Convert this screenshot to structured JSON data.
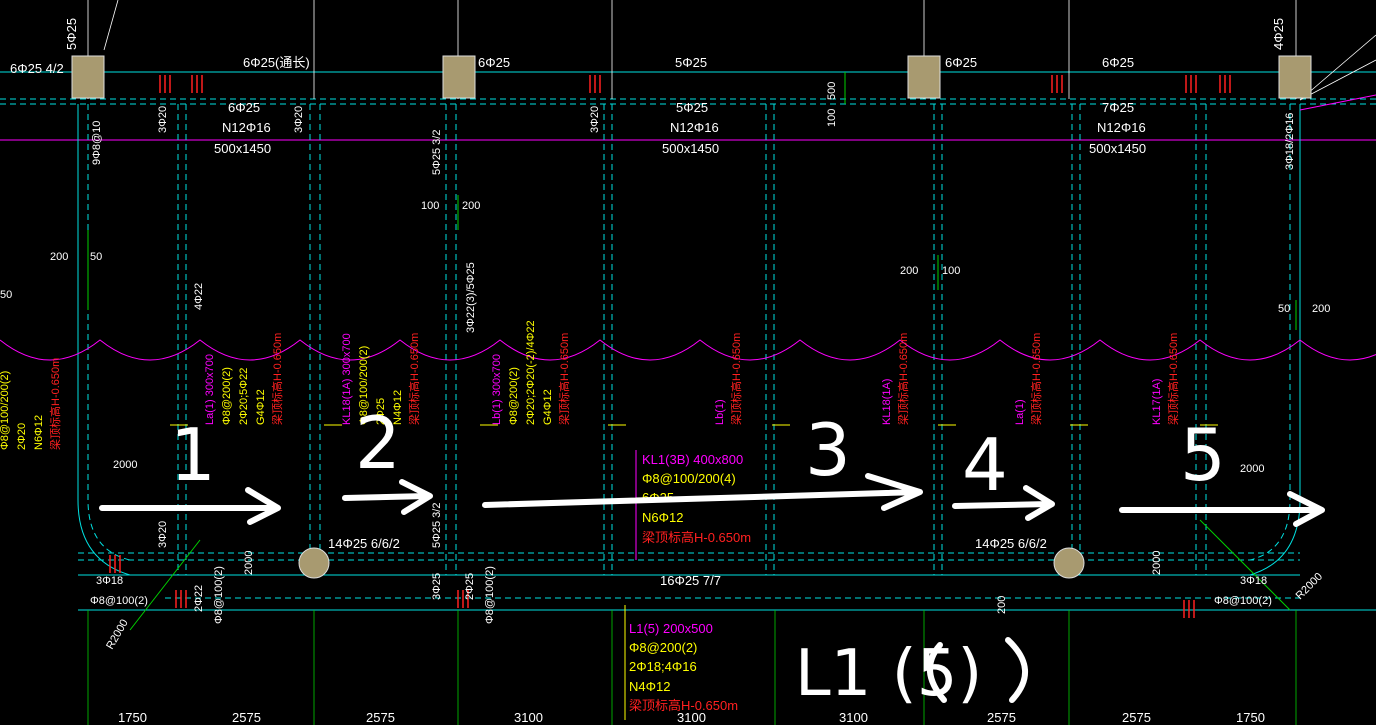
{
  "colors": {
    "bg": "#000000",
    "dim": "#ffffff",
    "grid_cyan": "#00e0e0",
    "green": "#00d000",
    "yellow": "#ffff00",
    "magenta": "#ff00ff",
    "red": "#ff2020",
    "column_fill": "#a89a70",
    "handwriting": "#ffffff"
  },
  "top_rebar": [
    "6Φ25 4/2",
    "6Φ25(通长)",
    "6Φ25",
    "5Φ25",
    "6Φ25",
    "6Φ25"
  ],
  "top_vertical": [
    "5Φ25",
    "4Φ25"
  ],
  "beam_groups": [
    {
      "rebar": "6Φ25",
      "torsion": "N12Φ16",
      "size": "500x1450"
    },
    {
      "rebar": "5Φ25",
      "torsion": "N12Φ16",
      "size": "500x1450"
    },
    {
      "rebar": "7Φ25",
      "torsion": "N12Φ16",
      "size": "500x1450"
    }
  ],
  "small_verticals": [
    "3Φ20",
    "3Φ20",
    "3Φ20",
    "5Φ25 3/2",
    "9Φ8@10",
    "3Φ18/2Φ16",
    "4Φ22",
    "3Φ22(3)/5Φ25"
  ],
  "dims_mid": [
    "200",
    "50",
    "50",
    "100",
    "200",
    "200",
    "100",
    "50",
    "200",
    "500",
    "100"
  ],
  "vertical_labels": [
    {
      "id": "lc1",
      "lines": [
        "Φ8@100/200(2)",
        "2Φ20",
        "N6Φ12",
        "梁顶标高H-0.650m"
      ]
    },
    {
      "id": "la1",
      "lines": [
        "La(1) 300x700",
        "Φ8@200(2)",
        "2Φ20;5Φ22",
        "G4Φ12",
        "梁顶标高H-0.650m"
      ]
    },
    {
      "id": "kl18a",
      "lines": [
        "KL18(1A) 300x700",
        "Φ8@100/200(2)",
        "2Φ25",
        "N4Φ12",
        "梁顶标高H-0.650m"
      ]
    },
    {
      "id": "lb1a",
      "lines": [
        "Lb(1) 300x700",
        "Φ8@200(2)",
        "2Φ20;2Φ20(-2)/4Φ22",
        "G4Φ12",
        "梁顶标高H-0.650m"
      ]
    },
    {
      "id": "lb1b",
      "lines": [
        "Lb(1)",
        "梁顶标高H-0.650m"
      ]
    },
    {
      "id": "kl18b",
      "lines": [
        "KL18(1A)",
        "梁顶标高H-0.650m"
      ]
    },
    {
      "id": "la1b",
      "lines": [
        "La(1)",
        "梁顶标高H-0.650m"
      ]
    },
    {
      "id": "kl17",
      "lines": [
        "KL17(1A)",
        "梁顶标高H-0.650m"
      ]
    }
  ],
  "kl1": [
    "KL1(3B) 400x800",
    "Φ8@100/200(4)",
    "6Φ25",
    "N6Φ12",
    "梁顶标高H-0.650m"
  ],
  "l1": [
    "L1(5) 200x500",
    "Φ8@200(2)",
    "2Φ18;4Φ16",
    "N4Φ12",
    "梁顶标高H-0.650m"
  ],
  "bottom_rebar": [
    "14Φ25 6/6/2",
    "16Φ25 7/7",
    "14Φ25 6/6/2"
  ],
  "bottom_small": [
    "3Φ18",
    "Φ8@100(2)",
    "2Φ22",
    "Φ8@100(2)",
    "3Φ25",
    "2Φ25",
    "Φ8@100(2)",
    "3Φ18",
    "Φ8@100(2)",
    "3Φ20",
    "5Φ25 3/2"
  ],
  "corner_dims": [
    "2000",
    "2000",
    "2000",
    "2000",
    "200",
    "R2000",
    "R2000"
  ],
  "bottom_dims": [
    "1750",
    "2575",
    "2575",
    "3100",
    "3100",
    "3100",
    "2575",
    "2575",
    "1750"
  ],
  "handwriting": {
    "n1": "1",
    "n2": "2",
    "n3": "3",
    "n4": "4",
    "n5": "5",
    "label": "L1 (5)"
  }
}
